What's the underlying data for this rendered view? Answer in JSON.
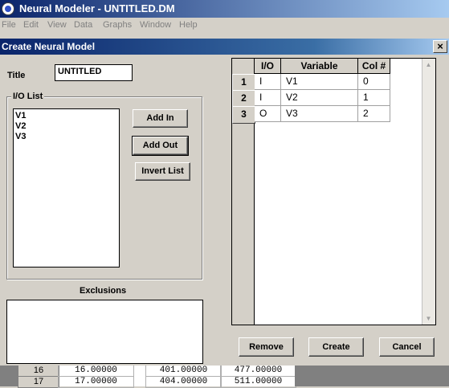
{
  "app": {
    "title": "Neural Modeler - UNTITLED.DM",
    "menu": [
      "File",
      "Edit",
      "View",
      "Data",
      "Graphs",
      "Window",
      "Help"
    ]
  },
  "dialog": {
    "title": "Create Neural Model",
    "close_glyph": "×",
    "title_label": "Title",
    "title_value": "UNTITLED",
    "io_list_label": "I/O List",
    "io_list_items": [
      "V1",
      "V2",
      "V3"
    ],
    "add_in": "Add In",
    "add_out": "Add Out",
    "invert_list": "Invert List",
    "exclusions_label": "Exclusions",
    "remove": "Remove",
    "create": "Create",
    "cancel": "Cancel"
  },
  "grid": {
    "headers": [
      "I/O",
      "Variable",
      "Col #"
    ],
    "rows": [
      {
        "num": "1",
        "io": "I",
        "variable": "V1",
        "col": "0"
      },
      {
        "num": "2",
        "io": "I",
        "variable": "V2",
        "col": "1"
      },
      {
        "num": "3",
        "io": "O",
        "variable": "V3",
        "col": "2"
      }
    ]
  },
  "background_table": {
    "rows": [
      {
        "num": "16",
        "values": [
          "16.00000",
          "401.00000",
          "477.00000"
        ]
      },
      {
        "num": "17",
        "values": [
          "17.00000",
          "404.00000",
          "511.00000"
        ]
      }
    ]
  }
}
